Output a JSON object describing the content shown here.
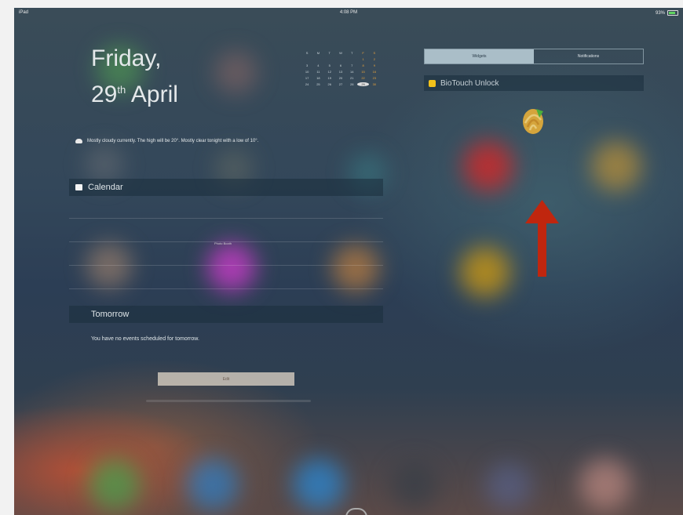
{
  "status_bar": {
    "carrier": "iPad",
    "time": "4:08 PM",
    "battery": "93%"
  },
  "today": {
    "weekday": "Friday,",
    "day_number": "29",
    "day_suffix": "th",
    "month": "April",
    "weather_text": "Mostly cloudy currently. The high will be 20°. Mostly clear tonight with a low of 10°.",
    "calendar_header": "Calendar",
    "calendar_days": [
      "S",
      "M",
      "T",
      "W",
      "T",
      "F",
      "S",
      "",
      "",
      "",
      "",
      "",
      "1",
      "2",
      "3",
      "4",
      "5",
      "6",
      "7",
      "8",
      "9",
      "10",
      "11",
      "12",
      "13",
      "14",
      "15",
      "16",
      "17",
      "18",
      "19",
      "20",
      "21",
      "22",
      "23",
      "24",
      "25",
      "26",
      "27",
      "28",
      "29",
      "30"
    ],
    "today_date": "29",
    "tomorrow_header": "Tomorrow",
    "tomorrow_text": "You have no events scheduled for tomorrow.",
    "edit_label": "Edit",
    "app_label": "Photo Booth"
  },
  "notification_center": {
    "tabs": [
      "Widgets",
      "Notifications"
    ],
    "active_tab": "Widgets",
    "widget_title": "BioTouch Unlock"
  },
  "colors": {
    "arrow": "#c0260e",
    "calendar_weekend": "#e9a23b",
    "unlock_icon": "#f2c21a"
  }
}
